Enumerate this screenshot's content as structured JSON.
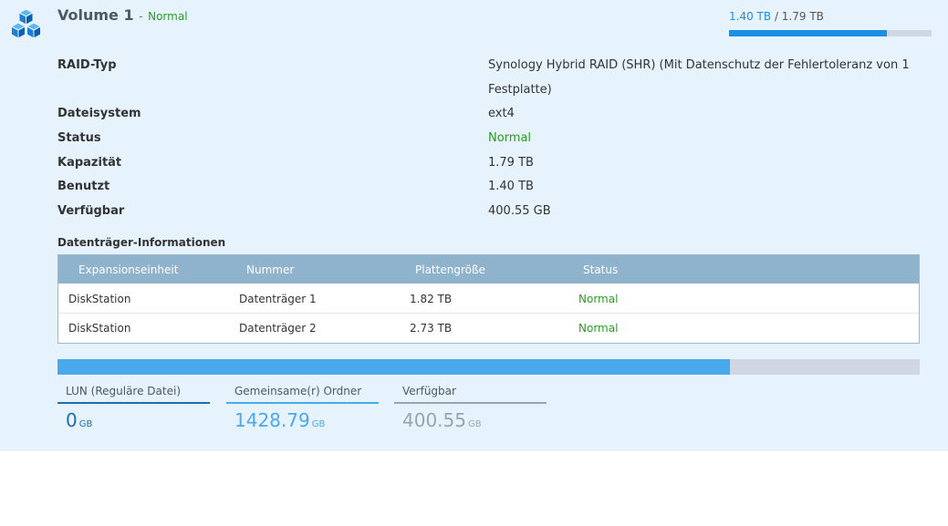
{
  "volume": {
    "title": "Volume 1",
    "separator": "-",
    "status": "Normal",
    "used": "1.40 TB",
    "total": "/ 1.79 TB",
    "usage_fraction": 0.78
  },
  "properties": [
    {
      "label": "RAID-Typ",
      "value_line1": "Synology Hybrid RAID (SHR) (Mit Datenschutz der Fehlertoleranz von 1",
      "value_line2": "Festplatte)"
    },
    {
      "label": "Dateisystem",
      "value": "ext4"
    },
    {
      "label": "Status",
      "value": "Normal"
    },
    {
      "label": "Kapazität",
      "value": "1.79 TB"
    },
    {
      "label": "Benutzt",
      "value": "1.40 TB"
    },
    {
      "label": "Verfügbar",
      "value": "400.55 GB"
    }
  ],
  "disk_info": {
    "heading": "Datenträger-Informationen",
    "columns": [
      "Expansionseinheit",
      "Nummer",
      "Plattengröße",
      "Status"
    ],
    "rows": [
      [
        "DiskStation",
        "Datenträger 1",
        "1.82 TB",
        "Normal"
      ],
      [
        "DiskStation",
        "Datenträger 2",
        "2.73 TB",
        "Normal"
      ]
    ]
  },
  "breakdown": {
    "usage_fraction": 0.78,
    "items": [
      {
        "label": "LUN (Reguläre Datei)",
        "value": "0",
        "unit": "GB"
      },
      {
        "label": "Gemeinsame(r) Ordner",
        "value": "1428.79",
        "unit": "GB"
      },
      {
        "label": "Verfügbar",
        "value": "400.55",
        "unit": "GB"
      }
    ]
  },
  "colors": {
    "panel_bg": "#e6f3fd",
    "status_green": "#2b9b23",
    "accent_blue": "#1a8fe6",
    "lun_blue": "#1a6fb3",
    "shared_blue": "#4aa8ec",
    "free_gray": "#9aa4ad",
    "table_header": "#8fb2cd"
  },
  "icons": {
    "volume": "volume-cubes-icon"
  }
}
